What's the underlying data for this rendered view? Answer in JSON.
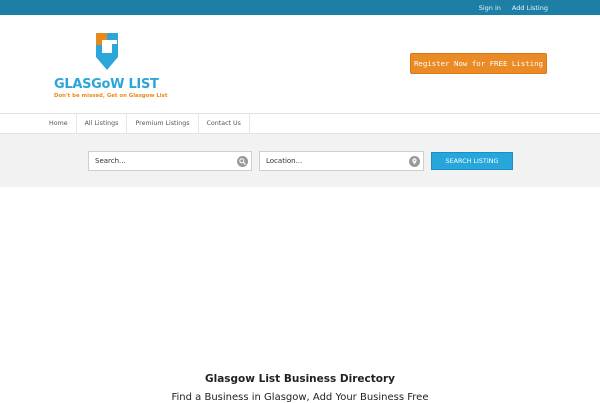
{
  "topbar": {
    "links": [
      "Sign in",
      "Add Listing"
    ]
  },
  "header": {
    "logo": {
      "title": "GLASGoW LIST",
      "tagline": "Don't be missed, Get on Glasgow List",
      "mark_icon": "map-pin-letter-g-icon",
      "colors": {
        "blue": "#2aa6d9",
        "orange": "#e88a1a"
      }
    },
    "register_button": "Register Now for FREE Listing"
  },
  "nav": {
    "items": [
      "Home",
      "All Listings",
      "Premium Listings",
      "Contact Us"
    ]
  },
  "search": {
    "keyword_placeholder": "Search...",
    "keyword_icon": "search-icon",
    "location_placeholder": "Location...",
    "location_icon": "location-pin-icon",
    "button": "SEARCH LISTING"
  },
  "main": {
    "title": "Glasgow List Business Directory",
    "subtitle": "Find a Business in Glasgow, Add Your Business Free"
  },
  "colors": {
    "topbar": "#1d7fa6",
    "accent_orange": "#ea8b25",
    "accent_blue": "#27a6dc",
    "search_band": "#f2f2f2"
  }
}
